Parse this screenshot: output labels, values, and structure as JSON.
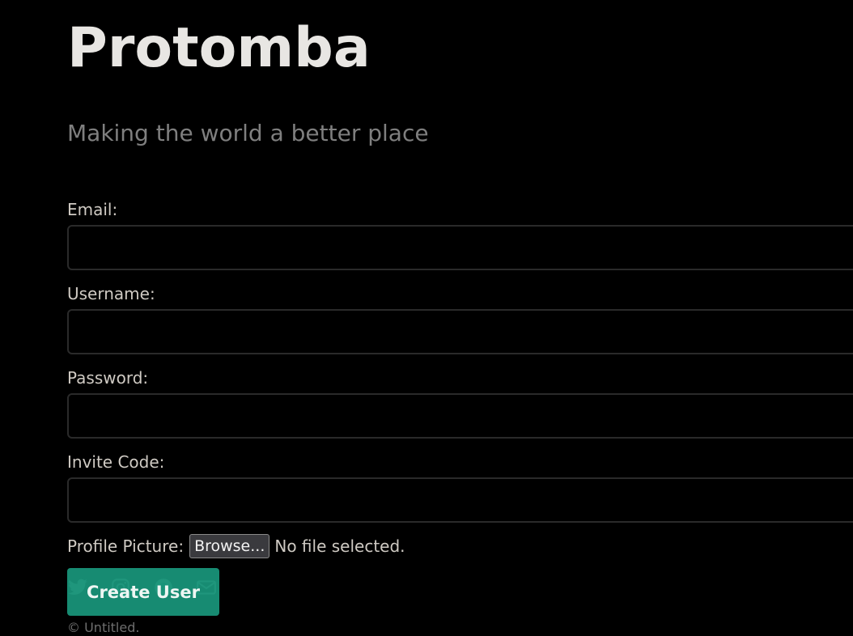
{
  "header": {
    "site_title": "Protomba",
    "tagline": "Making the world a better place"
  },
  "form": {
    "email_label": "Email:",
    "email_value": "",
    "username_label": "Username:",
    "username_value": "",
    "password_label": "Password:",
    "password_value": "",
    "invite_label": "Invite Code:",
    "invite_value": "",
    "profile_picture_label": "Profile Picture:",
    "browse_label": "Browse...",
    "file_status": "No file selected.",
    "submit_label": "Create User"
  },
  "footer": {
    "social_icons": [
      "twitter-icon",
      "instagram-icon",
      "github-icon",
      "email-icon"
    ],
    "copyright": "© Untitled."
  },
  "colors": {
    "background": "#000000",
    "accent": "#1a9e82",
    "title_text": "#e8e6e3",
    "muted_text": "#7f7f7f"
  }
}
